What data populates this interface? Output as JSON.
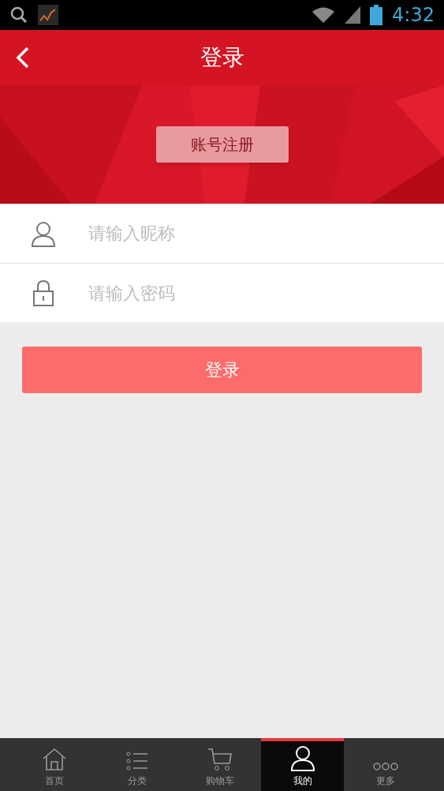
{
  "status_bar": {
    "time": "4:32"
  },
  "header": {
    "title": "登录"
  },
  "banner": {
    "register_button": "账号注册"
  },
  "fields": [
    {
      "kind": "user",
      "placeholder": "请输入昵称"
    },
    {
      "kind": "lock",
      "placeholder": "请输入密码"
    }
  ],
  "login_button": "登录",
  "tabs": [
    {
      "kind": "home",
      "label": "首页",
      "selected": false
    },
    {
      "kind": "list",
      "label": "分类",
      "selected": false
    },
    {
      "kind": "cart",
      "label": "购物车",
      "selected": false
    },
    {
      "kind": "user",
      "label": "我的",
      "selected": true
    },
    {
      "kind": "more",
      "label": "更多",
      "selected": false
    }
  ]
}
